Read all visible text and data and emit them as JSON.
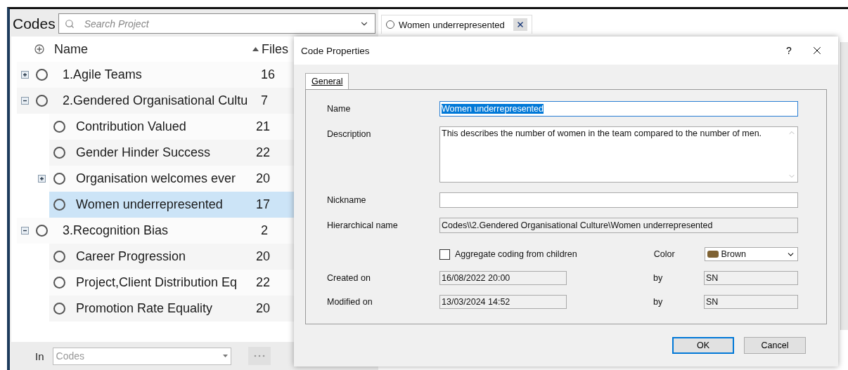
{
  "panel": {
    "title": "Codes",
    "search": {
      "placeholder": "Search Project"
    },
    "columns": [
      "Name",
      "Files"
    ],
    "tree": [
      {
        "name": "1.Agile Teams",
        "files": "16",
        "expanded": false,
        "selected": false
      },
      {
        "name": "2.Gendered Organisational Cultu",
        "files": "7",
        "expanded": true,
        "selected": false,
        "children": [
          {
            "name": "Contribution Valued",
            "files": "21",
            "selected": false
          },
          {
            "name": "Gender Hinder Success",
            "files": "22",
            "selected": false
          },
          {
            "name": "Organisation welcomes ever",
            "files": "20",
            "expanded": false,
            "selected": false
          },
          {
            "name": "Women underrepresented",
            "files": "17",
            "selected": true
          }
        ]
      },
      {
        "name": "3.Recognition Bias",
        "files": "2",
        "expanded": true,
        "selected": false,
        "children": [
          {
            "name": "Career Progression",
            "files": "20",
            "selected": false
          },
          {
            "name": "Project,Client Distribution Eq",
            "files": "22",
            "selected": false
          },
          {
            "name": "Promotion Rate Equality",
            "files": "20",
            "selected": false
          }
        ]
      }
    ],
    "footer": {
      "label": "In",
      "scope": {
        "placeholder": "Codes"
      }
    }
  },
  "open_tab": {
    "label": "Women underrepresented"
  },
  "dialog": {
    "title": "Code Properties",
    "help": "?",
    "tabs": [
      {
        "label": "General",
        "selected": true
      }
    ],
    "name": {
      "label": "Name",
      "value": "Women underrepresented",
      "text_selected": true
    },
    "description": {
      "label": "Description",
      "value": "This describes the number  of women in the team compared to the number of men."
    },
    "nickname": {
      "label": "Nickname"
    },
    "hierarchical": {
      "label": "Hierarchical name",
      "value": "Codes\\\\2.Gendered Organisational Culture\\Women underrepresented"
    },
    "aggregate": {
      "label": "Aggregate coding from children",
      "checked": false
    },
    "color": {
      "label": "Color",
      "value": "Brown",
      "color": "#7f6233"
    },
    "created": {
      "label": "Created on",
      "value": "16/08/2022 20:00",
      "by_label": "by",
      "by": "SN"
    },
    "modified": {
      "label": "Modified on",
      "value": "13/03/2024 14:52",
      "by_label": "by",
      "by": "SN"
    },
    "buttons": [
      {
        "label": "OK",
        "default": true
      },
      {
        "label": "Cancel",
        "default": false
      }
    ]
  }
}
